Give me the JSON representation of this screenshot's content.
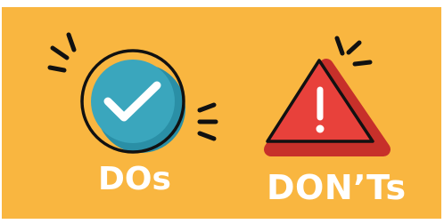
{
  "colors": {
    "background": "#f9b640",
    "check_circle": "#3aa6bd",
    "check_shadow": "#2a8fa6",
    "outline": "#111111",
    "warning_triangle": "#e8413b",
    "triangle_shadow": "#c7302a",
    "label_text": "#ffffff"
  },
  "icons": {
    "left": "check-circle-icon",
    "right": "warning-triangle-icon"
  },
  "labels": {
    "dos": "DOs",
    "donts": "DON’Ts"
  }
}
